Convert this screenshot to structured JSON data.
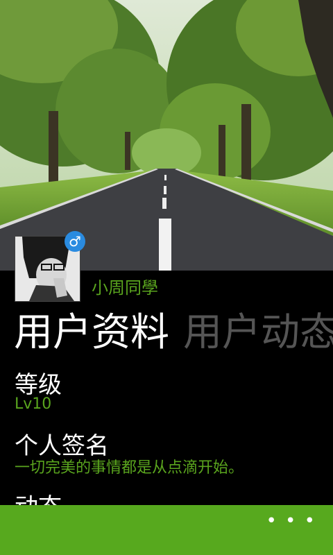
{
  "profile": {
    "username": "小周同學",
    "gender_icon": "♂"
  },
  "pivot": {
    "tabs": [
      {
        "label": "用户资料"
      },
      {
        "label": "用户动态"
      }
    ]
  },
  "fields": {
    "level": {
      "label": "等级",
      "value": "Lv10"
    },
    "signature": {
      "label": "个人签名",
      "value": "一切完美的事情都是从点滴开始。"
    },
    "activity": {
      "label": "动态"
    }
  },
  "appbar": {
    "more": "• • •"
  },
  "colors": {
    "accent": "#5aa51e",
    "appbar": "#57a91e",
    "badge": "#2a8be0"
  },
  "icons": {
    "gender": "male-icon",
    "more": "more-dots-icon"
  }
}
